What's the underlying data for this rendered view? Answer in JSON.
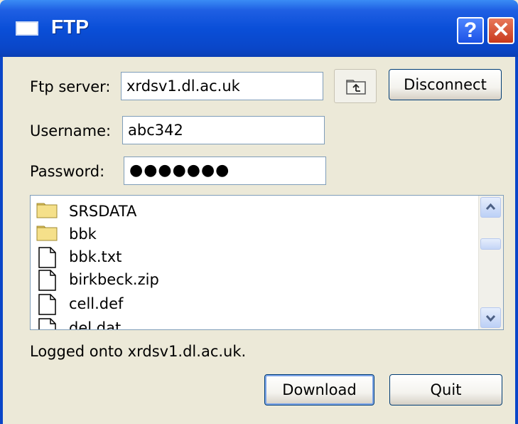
{
  "window": {
    "title": "FTP",
    "help_label": "?",
    "close_label": "✕"
  },
  "form": {
    "server_label": "Ftp server:",
    "server_value": "xrdsv1.dl.ac.uk",
    "username_label": "Username:",
    "username_value": "abc342",
    "password_label": "Password:",
    "password_value": "●●●●●●●",
    "disconnect_label": "Disconnect",
    "up_folder_icon": "folder-up-icon"
  },
  "files": [
    {
      "name": "SRSDATA",
      "type": "folder"
    },
    {
      "name": "bbk",
      "type": "folder"
    },
    {
      "name": "bbk.txt",
      "type": "file"
    },
    {
      "name": "birkbeck.zip",
      "type": "file"
    },
    {
      "name": "cell.def",
      "type": "file"
    },
    {
      "name": "del.dat",
      "type": "file"
    }
  ],
  "status": "Logged onto xrdsv1.dl.ac.uk.",
  "buttons": {
    "download": "Download",
    "quit": "Quit"
  },
  "colors": {
    "titlebar": "#0a46c8",
    "dialog_bg": "#ECE9D8",
    "folder": "#f5e08a"
  }
}
